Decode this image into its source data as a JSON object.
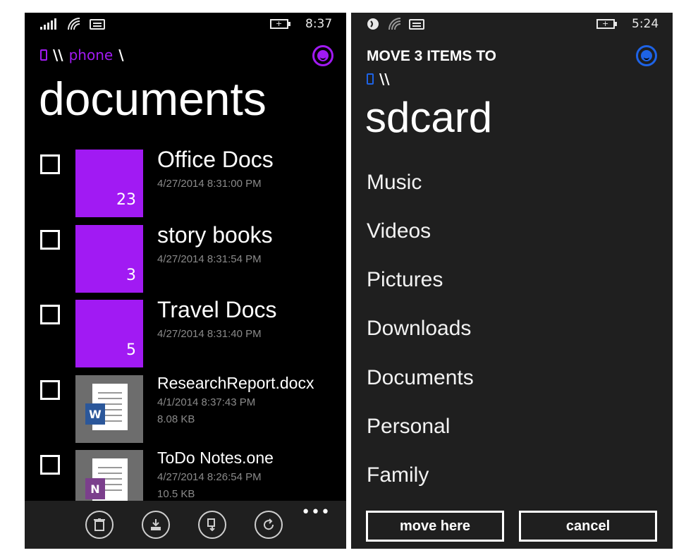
{
  "left": {
    "status": {
      "time": "8:37"
    },
    "breadcrumb": {
      "sep1": "\\\\",
      "location": "phone",
      "sep2": "\\"
    },
    "title": "documents",
    "items": [
      {
        "name": "Office Docs",
        "date": "4/27/2014 8:31:00 PM",
        "count": "23"
      },
      {
        "name": "story books",
        "date": "4/27/2014 8:31:54 PM",
        "count": "3"
      },
      {
        "name": "Travel Docs",
        "date": "4/27/2014 8:31:40 PM",
        "count": "5"
      },
      {
        "name": "ResearchReport.docx",
        "date": "4/1/2014 8:37:43 PM",
        "size": "8.08 KB",
        "badge": "W"
      },
      {
        "name": "ToDo Notes.one",
        "date": "4/27/2014 8:26:54 PM",
        "size": "10.5 KB",
        "badge": "N"
      }
    ],
    "appbar": {
      "icons": [
        "delete-icon",
        "download-icon",
        "copy-move-icon",
        "sync-icon"
      ],
      "more": "•••"
    },
    "accent": "#a11af3"
  },
  "right": {
    "status": {
      "time": "5:24"
    },
    "header": "MOVE 3 ITEMS TO",
    "breadcrumb": {
      "sep": "\\\\"
    },
    "title": "sdcard",
    "folders": [
      "Music",
      "Videos",
      "Pictures",
      "Downloads",
      "Documents",
      "Personal",
      "Family"
    ],
    "buttons": {
      "move": "move here",
      "cancel": "cancel"
    },
    "accent": "#1e63e6"
  }
}
